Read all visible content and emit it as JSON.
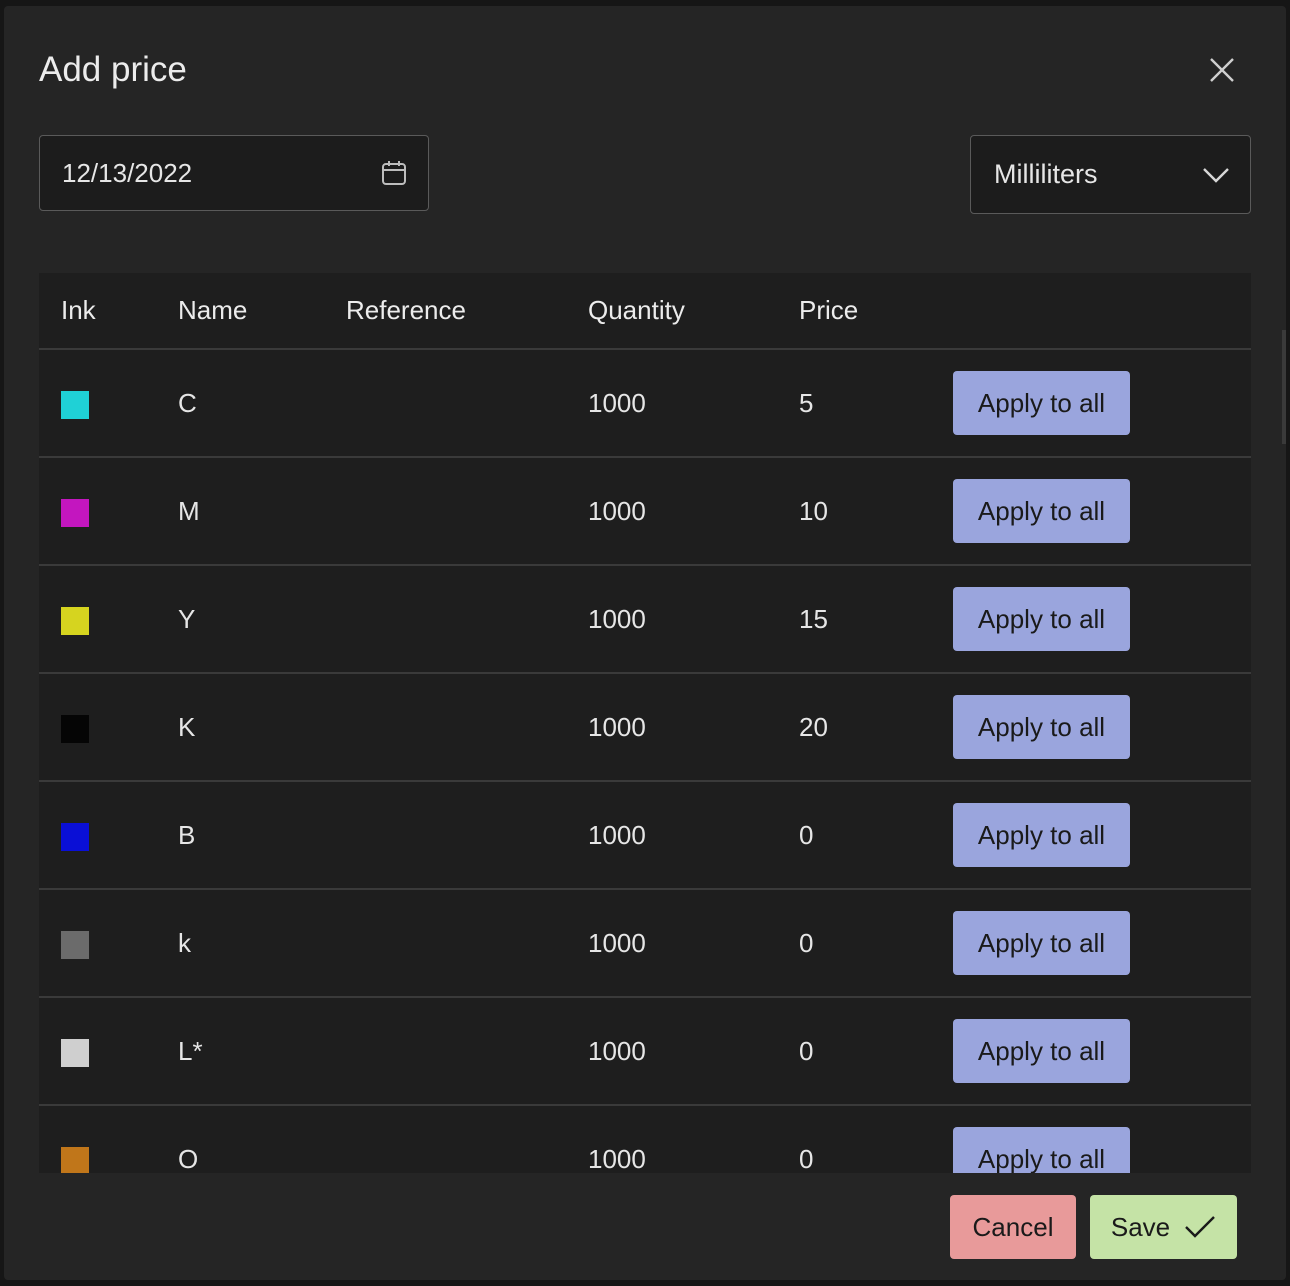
{
  "dialog": {
    "title": "Add price"
  },
  "date_field": {
    "value": "12/13/2022"
  },
  "unit_select": {
    "value": "Milliliters"
  },
  "table": {
    "headers": {
      "ink": "Ink",
      "name": "Name",
      "reference": "Reference",
      "quantity": "Quantity",
      "price": "Price"
    },
    "rows": [
      {
        "color": "#1fd1d6",
        "name": "C",
        "reference": "",
        "quantity": "1000",
        "price": "5",
        "action": "Apply to all"
      },
      {
        "color": "#c316bf",
        "name": "M",
        "reference": "",
        "quantity": "1000",
        "price": "10",
        "action": "Apply to all"
      },
      {
        "color": "#d6d41f",
        "name": "Y",
        "reference": "",
        "quantity": "1000",
        "price": "15",
        "action": "Apply to all"
      },
      {
        "color": "#050505",
        "name": "K",
        "reference": "",
        "quantity": "1000",
        "price": "20",
        "action": "Apply to all"
      },
      {
        "color": "#0a0fd6",
        "name": "B",
        "reference": "",
        "quantity": "1000",
        "price": "0",
        "action": "Apply to all"
      },
      {
        "color": "#6b6b6b",
        "name": "k",
        "reference": "",
        "quantity": "1000",
        "price": "0",
        "action": "Apply to all"
      },
      {
        "color": "#cfcfcf",
        "name": "L*",
        "reference": "",
        "quantity": "1000",
        "price": "0",
        "action": "Apply to all"
      },
      {
        "color": "#c0761a",
        "name": "O",
        "reference": "",
        "quantity": "1000",
        "price": "0",
        "action": "Apply to all"
      }
    ]
  },
  "footer": {
    "cancel_label": "Cancel",
    "save_label": "Save"
  }
}
